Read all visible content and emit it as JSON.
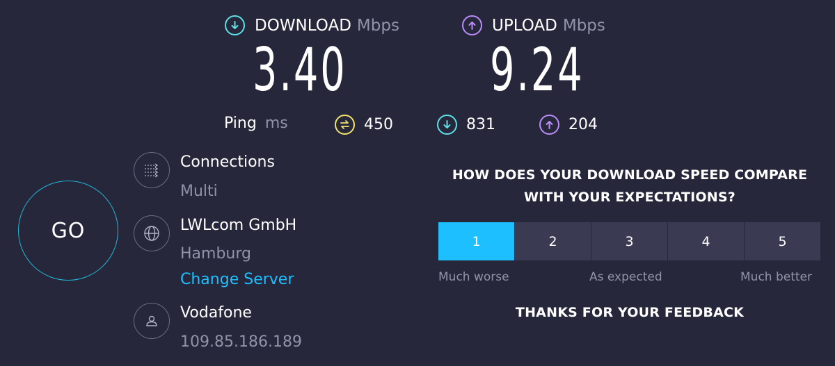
{
  "download": {
    "label": "DOWNLOAD",
    "unit": "Mbps",
    "value": "3.40",
    "icon": "download-arrow-icon",
    "color": "#5de0e6"
  },
  "upload": {
    "label": "UPLOAD",
    "unit": "Mbps",
    "value": "9.24",
    "icon": "upload-arrow-icon",
    "color": "#b98cf8"
  },
  "ping": {
    "label": "Ping",
    "unit": "ms",
    "idle": "450",
    "download": "831",
    "upload": "204",
    "idle_color": "#f4e36b"
  },
  "go_button": {
    "label": "GO"
  },
  "connections": {
    "title": "Connections",
    "value": "Multi",
    "icon": "connections-icon"
  },
  "server": {
    "name": "LWLcom GmbH",
    "location": "Hamburg",
    "change_label": "Change Server",
    "icon": "globe-icon"
  },
  "provider": {
    "name": "Vodafone",
    "ip": "109.85.186.189",
    "icon": "user-icon"
  },
  "survey": {
    "question_line1": "HOW DOES YOUR DOWNLOAD SPEED COMPARE",
    "question_line2": "WITH YOUR EXPECTATIONS?",
    "options": [
      "1",
      "2",
      "3",
      "4",
      "5"
    ],
    "selected": "1",
    "low_label": "Much worse",
    "mid_label": "As expected",
    "high_label": "Much better",
    "thanks": "THANKS FOR YOUR FEEDBACK"
  }
}
